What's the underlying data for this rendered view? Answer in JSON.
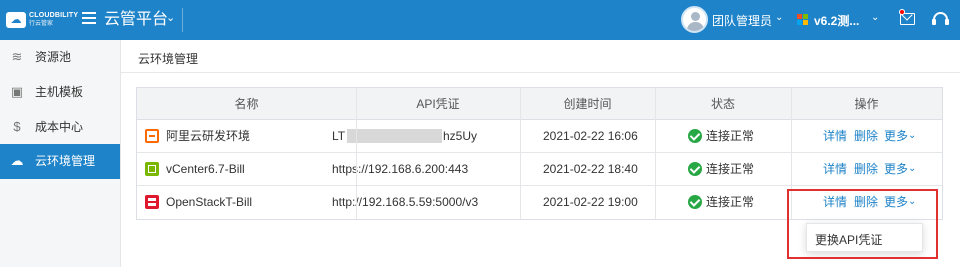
{
  "header": {
    "logo_text": "CLOUDBILITY",
    "logo_sub": "行云管家",
    "app_title": "云管平台",
    "user_name": "团队管理员",
    "version": "v6.2测..."
  },
  "sidebar": {
    "items": [
      {
        "label": "资源池",
        "icon": "stack-icon"
      },
      {
        "label": "主机模板",
        "icon": "template-icon"
      },
      {
        "label": "成本中心",
        "icon": "dollar-icon"
      },
      {
        "label": "云环境管理",
        "icon": "cloud-gear-icon",
        "active": true
      }
    ]
  },
  "page": {
    "title": "云环境管理"
  },
  "table": {
    "headers": [
      "名称",
      "API凭证",
      "创建时间",
      "状态",
      "操作"
    ],
    "rows": [
      {
        "name": "阿里云研发环境",
        "provider_icon": "aliyun-icon",
        "credential_prefix": "LT",
        "credential_suffix": "hz5Uy",
        "created": "2021-02-22 16:06",
        "status": "连接正常",
        "actions": [
          "详情",
          "删除",
          "更多"
        ]
      },
      {
        "name": "vCenter6.7-Bill",
        "provider_icon": "vmware-icon",
        "credential": "https://192.168.6.200:443",
        "created": "2021-02-22 18:40",
        "status": "连接正常",
        "actions": [
          "详情",
          "删除",
          "更多"
        ]
      },
      {
        "name": "OpenStackT-Bill",
        "provider_icon": "openstack-icon",
        "credential": "http://192.168.5.59:5000/v3",
        "created": "2021-02-22 19:00",
        "status": "连接正常",
        "actions": [
          "详情",
          "删除",
          "更多"
        ]
      }
    ]
  },
  "dropdown": {
    "item": "更换API凭证"
  },
  "colors": {
    "primary": "#1e83c8",
    "success": "#27a844",
    "highlight": "#e03030"
  }
}
